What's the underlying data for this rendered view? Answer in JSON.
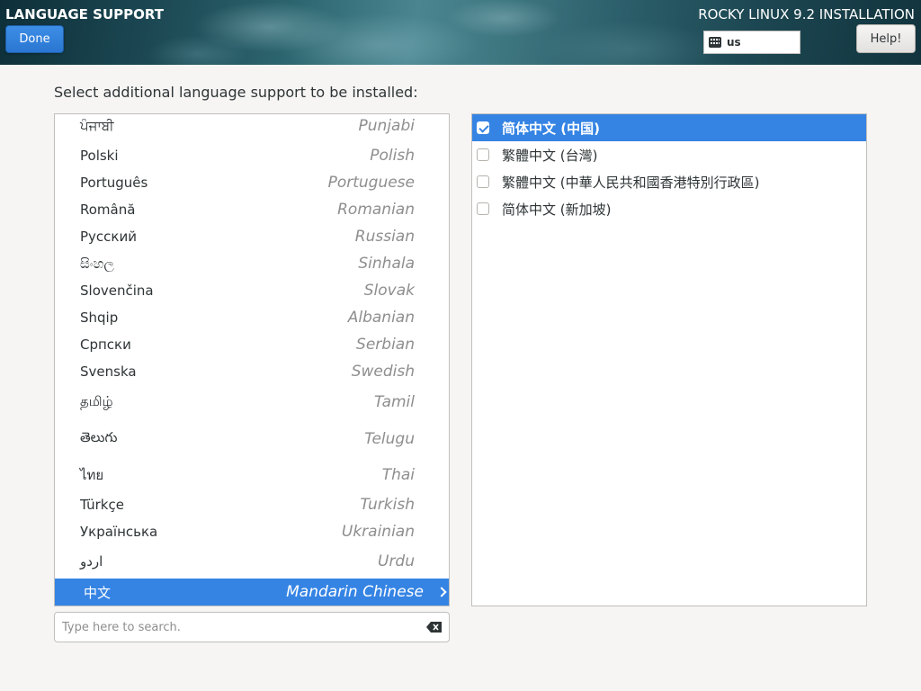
{
  "header": {
    "title": "LANGUAGE SUPPORT",
    "done_label": "Done",
    "product_title": "ROCKY LINUX 9.2 INSTALLATION",
    "keyboard_layout": "us",
    "help_label": "Help!"
  },
  "instruction": "Select additional language support to be installed:",
  "languages": [
    {
      "native": "ਪੰਜਾਬੀ",
      "english": "Punjabi"
    },
    {
      "native": "Polski",
      "english": "Polish"
    },
    {
      "native": "Português",
      "english": "Portuguese"
    },
    {
      "native": "Română",
      "english": "Romanian"
    },
    {
      "native": "Русский",
      "english": "Russian"
    },
    {
      "native": "සිංහල",
      "english": "Sinhala"
    },
    {
      "native": "Slovenčina",
      "english": "Slovak"
    },
    {
      "native": "Shqip",
      "english": "Albanian"
    },
    {
      "native": "Српски",
      "english": "Serbian"
    },
    {
      "native": "Svenska",
      "english": "Swedish"
    },
    {
      "native": "தமிழ்",
      "english": "Tamil"
    },
    {
      "native": "తెలుగు",
      "english": "Telugu"
    },
    {
      "native": "ไทย",
      "english": "Thai"
    },
    {
      "native": "Türkçe",
      "english": "Turkish"
    },
    {
      "native": "Українська",
      "english": "Ukrainian"
    },
    {
      "native": "اردو",
      "english": "Urdu"
    },
    {
      "native": "中文",
      "english": "Mandarin Chinese",
      "selected": true
    }
  ],
  "locales": [
    {
      "label": "简体中文 (中国)",
      "checked": true
    },
    {
      "label": "繁體中文 (台灣)",
      "checked": false
    },
    {
      "label": "繁體中文 (中華人民共和國香港特別行政區)",
      "checked": false
    },
    {
      "label": "简体中文 (新加坡)",
      "checked": false
    }
  ],
  "search": {
    "placeholder": "Type here to search.",
    "value": ""
  },
  "colors": {
    "accent": "#3584e4",
    "background": "#f6f5f4"
  }
}
